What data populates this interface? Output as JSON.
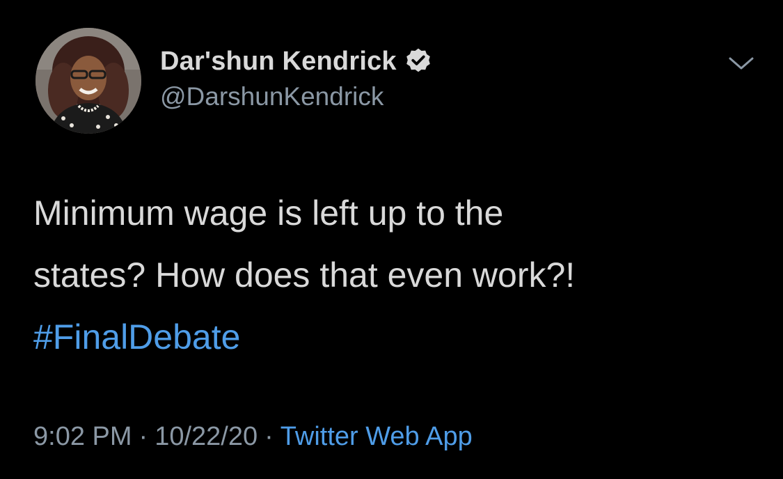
{
  "author": {
    "display_name": "Dar'shun Kendrick",
    "handle": "@DarshunKendrick",
    "verified": true
  },
  "tweet": {
    "lines": [
      "Minimum wage is left up to the",
      "states? How does that even work?!"
    ],
    "hashtag": "#FinalDebate"
  },
  "meta": {
    "time": "9:02 PM",
    "separator": "·",
    "date": "10/22/20",
    "source": "Twitter Web App"
  },
  "icons": {
    "verified": "verified-badge-icon",
    "more": "chevron-down-icon"
  },
  "colors": {
    "background": "#000000",
    "text": "#d9d9d9",
    "secondary": "#8b98a5",
    "accent": "#4f9de8"
  }
}
